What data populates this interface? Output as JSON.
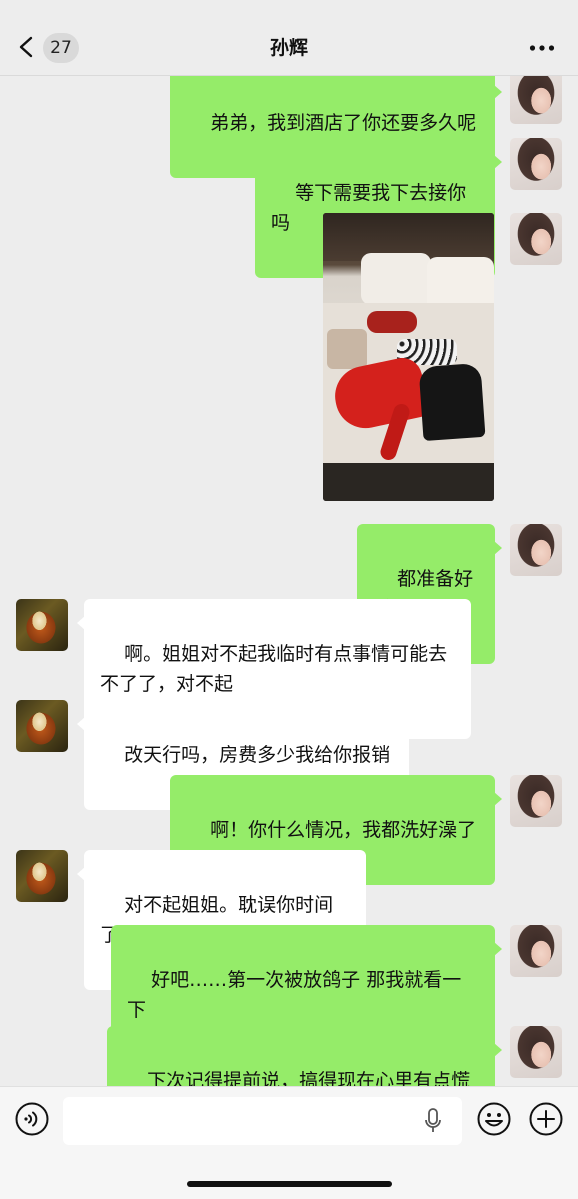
{
  "header": {
    "unread_count": "27",
    "title": "孙辉",
    "back_icon": "chevron-left-icon",
    "more_icon": "more-dots-icon"
  },
  "messages": [
    {
      "sender": "me",
      "text": "弟弟，我到酒店了你还要多久呢"
    },
    {
      "sender": "me",
      "text": "等下需要我下去接你吗"
    },
    {
      "sender": "me",
      "type": "image",
      "alt": ""
    },
    {
      "sender": "me",
      "text": "都准备好啦"
    },
    {
      "sender": "other",
      "text": "啊。姐姐对不起我临时有点事情可能去\n不了了，对不起"
    },
    {
      "sender": "other",
      "text": "改天行吗，房费多少我给你报销"
    },
    {
      "sender": "me",
      "text": "啊！你什么情况，我都洗好澡了"
    },
    {
      "sender": "other",
      "text": "对不起姐姐。耽误你时间了"
    },
    {
      "sender": "me",
      "text": "好吧……第一次被放鸽子 那我就看一下\n可以不可以退房吧"
    },
    {
      "sender": "me",
      "text": "下次记得提前说，搞得现在心里有点慌"
    }
  ],
  "input_bar": {
    "text_value": "",
    "voice_icon": "voice-toggle-icon",
    "mic_icon": "microphone-icon",
    "emoji_icon": "emoji-icon",
    "plus_icon": "plus-icon"
  },
  "colors": {
    "my_bubble": "#95ec69",
    "other_bubble": "#ffffff",
    "background": "#ededed"
  }
}
